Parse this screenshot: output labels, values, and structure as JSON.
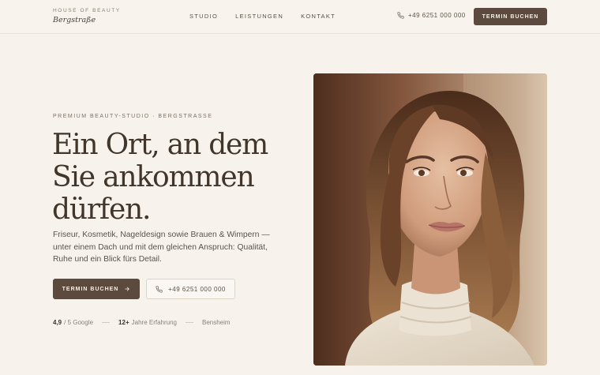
{
  "header": {
    "brand_top": "HOUSE OF BEAUTY",
    "brand_name": "Bergstraße",
    "nav": [
      {
        "label": "STUDIO"
      },
      {
        "label": "LEISTUNGEN"
      },
      {
        "label": "KONTAKT"
      }
    ],
    "phone": "+49 6251 000 000",
    "cta": "TERMIN BUCHEN"
  },
  "hero": {
    "eyebrow": "PREMIUM BEAUTY-STUDIO · BERGSTRASSE",
    "headline": [
      "Ein Ort, an dem",
      "Sie ankommen",
      "dürfen."
    ],
    "lead": "Friseur, Kosmetik, Nageldesign sowie Brauen & Wimpern — unter einem Dach und mit dem gleichen Anspruch: Qualität, Ruhe und ein Blick fürs Detail.",
    "cta_primary": "TERMIN BUCHEN",
    "cta_phone": "+49 6251 000 000",
    "stats": {
      "rating_value": "4,9",
      "rating_suffix": "/ 5 Google",
      "years_value": "12+",
      "years_suffix": "Jahre Erfahrung",
      "location": "Bensheim"
    }
  },
  "colors": {
    "background": "#f7f3ec",
    "accent": "#5b4a3d",
    "text": "#3d342c"
  },
  "icons": {
    "phone": "phone-icon",
    "arrow": "arrow-right-icon"
  }
}
